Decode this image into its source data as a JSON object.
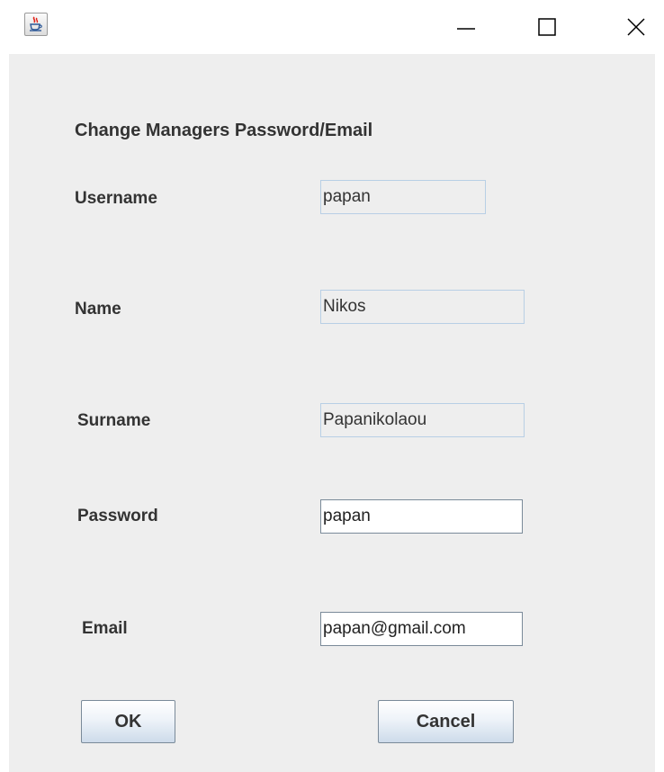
{
  "window": {
    "icon": "java-cup-icon",
    "controls": {
      "minimize": "minimize-icon",
      "maximize": "maximize-icon",
      "close": "close-icon"
    }
  },
  "form": {
    "heading": "Change Managers Password/Email",
    "fields": {
      "username": {
        "label": "Username",
        "value": "papan"
      },
      "name": {
        "label": "Name",
        "value": "Nikos"
      },
      "surname": {
        "label": "Surname",
        "value": "Papanikolaou"
      },
      "password": {
        "label": "Password",
        "value": "papan"
      },
      "email": {
        "label": "Email",
        "value": "papan@gmail.com"
      }
    },
    "buttons": {
      "ok": "OK",
      "cancel": "Cancel"
    }
  },
  "colors": {
    "panel_bg": "#eeeeee",
    "text": "#333333",
    "readonly_border": "#b8cfe5",
    "editable_border": "#7a8a99"
  }
}
